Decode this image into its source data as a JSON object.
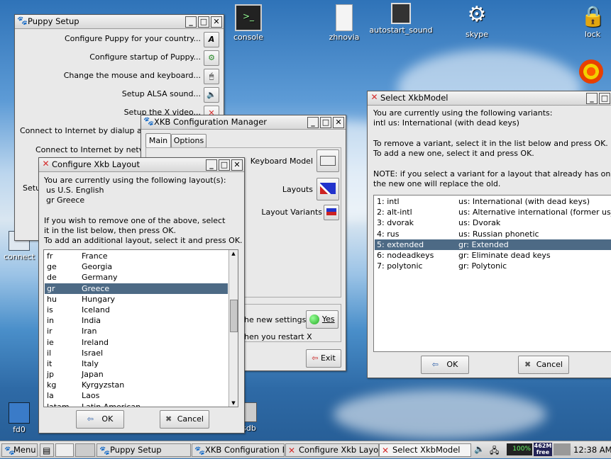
{
  "desktop": {
    "icons": [
      {
        "name": "console",
        "label": "console"
      },
      {
        "name": "zhnovia",
        "label": "zhnovia"
      },
      {
        "name": "autostart",
        "label": "autostart_sound"
      },
      {
        "name": "skype",
        "label": "skype"
      },
      {
        "name": "lock",
        "label": "lock"
      },
      {
        "name": "fd0",
        "label": "fd0"
      },
      {
        "name": "sdb",
        "label": "sdb"
      },
      {
        "name": "connect",
        "label": "connect"
      }
    ]
  },
  "puppy_setup": {
    "title": "Puppy Setup",
    "items": [
      "Configure Puppy for your country...",
      "Configure startup of Puppy...",
      "Change the mouse and keyboard...",
      "Setup ALSA sound...",
      "Setup the X video...",
      "Connect to Internet by dialup ar",
      "Connect to Internet by netv",
      "Setu"
    ]
  },
  "xkb_manager": {
    "title": "XKB Configuration Manager",
    "tabs": [
      "Main",
      "Options"
    ],
    "keyboard_model": "Keyboard Model",
    "layouts": "Layouts",
    "layout_variants": "Layout Variants",
    "new_settings": "he new settings",
    "yes": "Yes",
    "restart": "hen you restart X",
    "exit": "Exit"
  },
  "xkb_layout": {
    "title": "Configure Xkb Layout",
    "intro": "You are currently using the following layout(s):",
    "current": [
      "us U.S. English",
      "gr Greece"
    ],
    "help1": "If you wish to remove one of the above, select",
    "help2": " it in the list below, then press OK.",
    "help3": "To add an additional layout, select it and press OK.",
    "layouts": [
      {
        "code": "fr",
        "name": "France"
      },
      {
        "code": "ge",
        "name": "Georgia"
      },
      {
        "code": "de",
        "name": "Germany"
      },
      {
        "code": "gr",
        "name": "Greece",
        "selected": true
      },
      {
        "code": "hu",
        "name": "Hungary"
      },
      {
        "code": "is",
        "name": "Iceland"
      },
      {
        "code": "in",
        "name": "India"
      },
      {
        "code": "ir",
        "name": "Iran"
      },
      {
        "code": "ie",
        "name": "Ireland"
      },
      {
        "code": "il",
        "name": "Israel"
      },
      {
        "code": "it",
        "name": "Italy"
      },
      {
        "code": "jp",
        "name": "Japan"
      },
      {
        "code": "kg",
        "name": "Kyrgyzstan"
      },
      {
        "code": "la",
        "name": "Laos"
      },
      {
        "code": "latam",
        "name": "Latin American"
      }
    ],
    "ok": "OK",
    "cancel": "Cancel"
  },
  "xkb_model": {
    "title": "Select XkbModel",
    "intro": "You are currently using the following variants:",
    "current": " intl us: International (with dead keys)",
    "remove": "To remove a variant, select it in the list below and press OK.",
    "add": "To add a new one, select it and press OK.",
    "note1": "NOTE: if you select a variant for a layout that already has one",
    "note2": " the new one will replace the old.",
    "variants": [
      {
        "id": "1: intl",
        "desc": "us: International (with dead keys)"
      },
      {
        "id": "2: alt-intl",
        "desc": "us: Alternative international (former us_"
      },
      {
        "id": "3: dvorak",
        "desc": "us: Dvorak"
      },
      {
        "id": "4: rus",
        "desc": "us: Russian phonetic"
      },
      {
        "id": "5: extended",
        "desc": "gr: Extended",
        "selected": true
      },
      {
        "id": "6: nodeadkeys",
        "desc": "gr: Eliminate dead keys"
      },
      {
        "id": "7: polytonic",
        "desc": "gr: Polytonic"
      }
    ],
    "ok": "OK",
    "cancel": "Cancel"
  },
  "taskbar": {
    "menu": "Menu",
    "tasks": [
      "Puppy Setup",
      "XKB Configuration M",
      "Configure Xkb Layo",
      "Select XkbModel"
    ],
    "cpu": "100%",
    "mem": "462M",
    "mem_label": "free",
    "clock": "12:38 AM"
  },
  "colors": {
    "selection": "#4d6a85",
    "close_x": "#d42a2a"
  }
}
